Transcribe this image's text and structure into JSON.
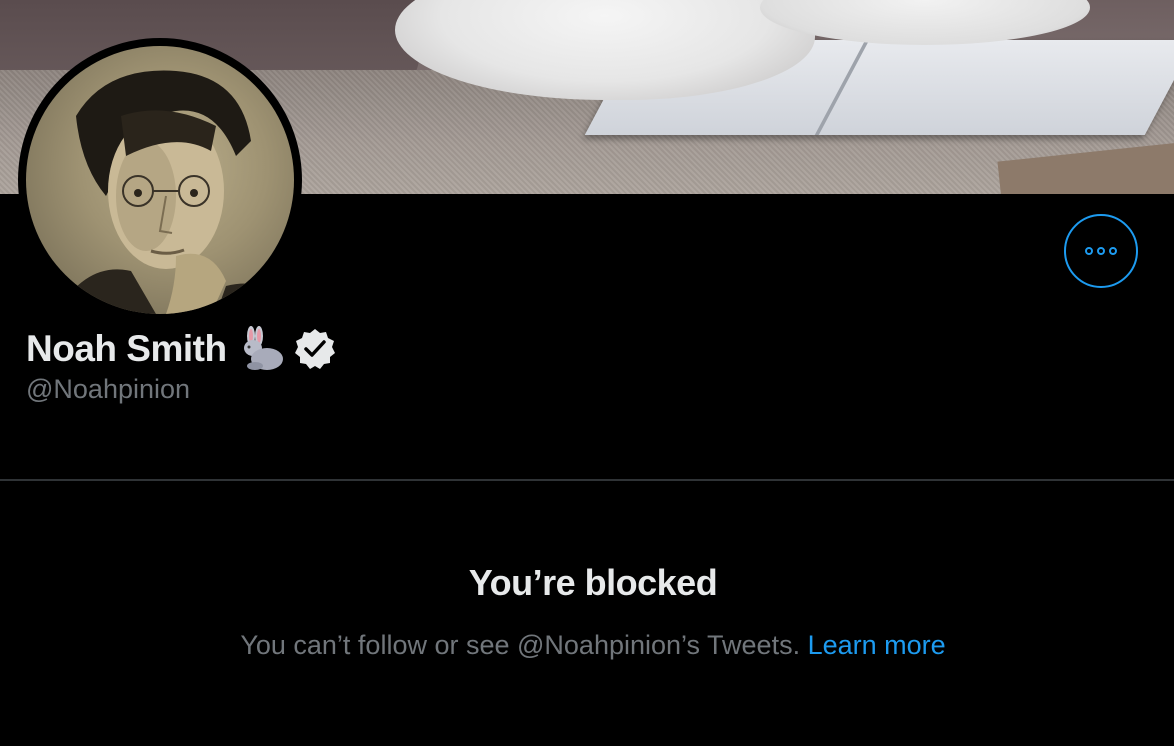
{
  "profile": {
    "display_name": "Noah Smith",
    "handle": "@Noahpinion",
    "name_emoji": "rabbit-icon",
    "verified": true
  },
  "actions": {
    "more_icon": "more-horizontal-icon"
  },
  "blocked": {
    "title": "You’re blocked",
    "description": "You can’t follow or see @Noahpinion’s Tweets.",
    "learn_more": "Learn more"
  },
  "colors": {
    "background": "#000000",
    "accent": "#1d9bf0",
    "primary_text": "#e7e9ea",
    "secondary_text": "#71767b",
    "divider": "#2f3336"
  }
}
